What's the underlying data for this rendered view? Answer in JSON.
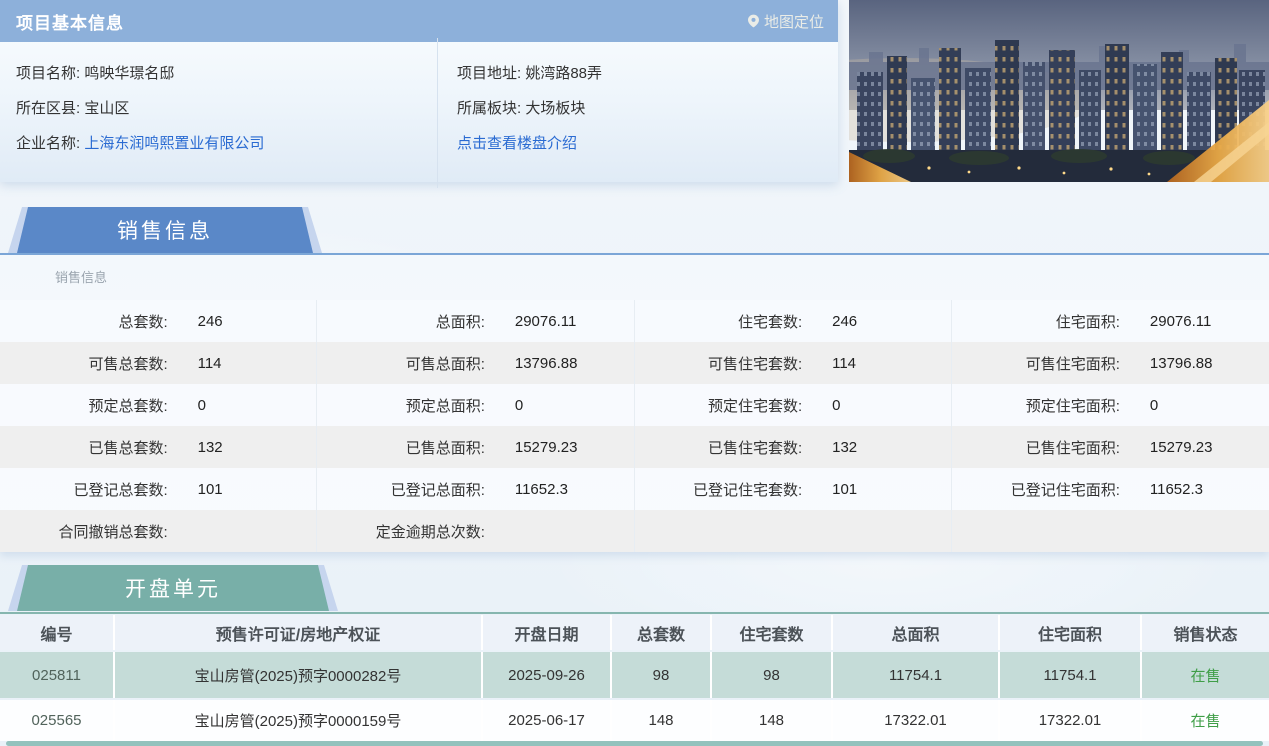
{
  "colors": {
    "header_bar": "#8db0da",
    "accent_blue": "#5a88c8",
    "accent_teal": "#78afa8",
    "link_blue": "#2a6bd2",
    "status_green": "#3f9e47",
    "row_teal": "#c5dcd8"
  },
  "project_info": {
    "title": "项目基本信息",
    "map_link_label": "地图定位",
    "left_fields": [
      {
        "label": "项目名称:",
        "value": "鸣映华璟名邸",
        "link": false
      },
      {
        "label": "所在区县:",
        "value": "宝山区",
        "link": false
      },
      {
        "label": "企业名称:",
        "value": "上海东润鸣熙置业有限公司",
        "link": true
      }
    ],
    "right_fields": [
      {
        "label": "项目地址:",
        "value": "姚湾路88弄",
        "link": false
      },
      {
        "label": "所属板块:",
        "value": "大场板块",
        "link": false
      },
      {
        "label": "",
        "value": "点击查看楼盘介绍",
        "link": true
      }
    ]
  },
  "sales_section": {
    "tab_label": "销售信息",
    "sub_label": "销售信息",
    "rows": [
      [
        {
          "label": "总套数:",
          "value": "246"
        },
        {
          "label": "总面积:",
          "value": "29076.11"
        },
        {
          "label": "住宅套数:",
          "value": "246"
        },
        {
          "label": "住宅面积:",
          "value": "29076.11"
        }
      ],
      [
        {
          "label": "可售总套数:",
          "value": "114"
        },
        {
          "label": "可售总面积:",
          "value": "13796.88"
        },
        {
          "label": "可售住宅套数:",
          "value": "114"
        },
        {
          "label": "可售住宅面积:",
          "value": "13796.88"
        }
      ],
      [
        {
          "label": "预定总套数:",
          "value": "0"
        },
        {
          "label": "预定总面积:",
          "value": "0"
        },
        {
          "label": "预定住宅套数:",
          "value": "0"
        },
        {
          "label": "预定住宅面积:",
          "value": "0"
        }
      ],
      [
        {
          "label": "已售总套数:",
          "value": "132"
        },
        {
          "label": "已售总面积:",
          "value": "15279.23"
        },
        {
          "label": "已售住宅套数:",
          "value": "132"
        },
        {
          "label": "已售住宅面积:",
          "value": "15279.23"
        }
      ],
      [
        {
          "label": "已登记总套数:",
          "value": "101"
        },
        {
          "label": "已登记总面积:",
          "value": "11652.3"
        },
        {
          "label": "已登记住宅套数:",
          "value": "101"
        },
        {
          "label": "已登记住宅面积:",
          "value": "11652.3"
        }
      ],
      [
        {
          "label": "合同撤销总套数:",
          "value": ""
        },
        {
          "label": "定金逾期总次数:",
          "value": ""
        },
        {
          "label": "",
          "value": ""
        },
        {
          "label": "",
          "value": ""
        }
      ]
    ]
  },
  "units_section": {
    "tab_label": "开盘单元",
    "headers": [
      "编号",
      "预售许可证/房地产权证",
      "开盘日期",
      "总套数",
      "住宅套数",
      "总面积",
      "住宅面积",
      "销售状态"
    ],
    "rows": [
      [
        "025811",
        "宝山房管(2025)预字0000282号",
        "2025-09-26",
        "98",
        "98",
        "11754.1",
        "11754.1",
        "在售"
      ],
      [
        "025565",
        "宝山房管(2025)预字0000159号",
        "2025-06-17",
        "148",
        "148",
        "17322.01",
        "17322.01",
        "在售"
      ]
    ]
  }
}
